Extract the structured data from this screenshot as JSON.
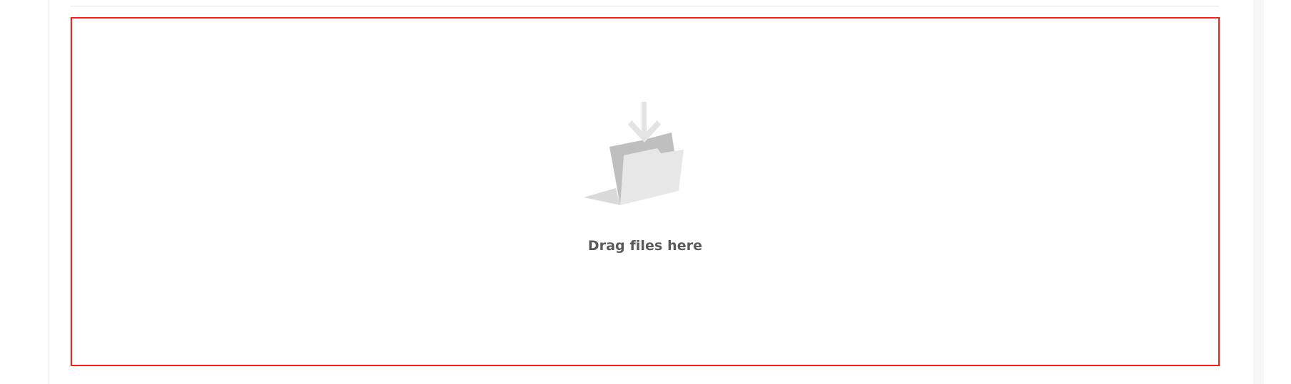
{
  "upload": {
    "drop_label": "Drag files here",
    "icon": "folder-download-icon",
    "border_color": "#ff1a1a"
  },
  "colors": {
    "folder_back": "#bfbfbf",
    "folder_front": "#e7e7e7",
    "arrow": "#e4e4e4",
    "label_text": "#5a5a5a"
  }
}
